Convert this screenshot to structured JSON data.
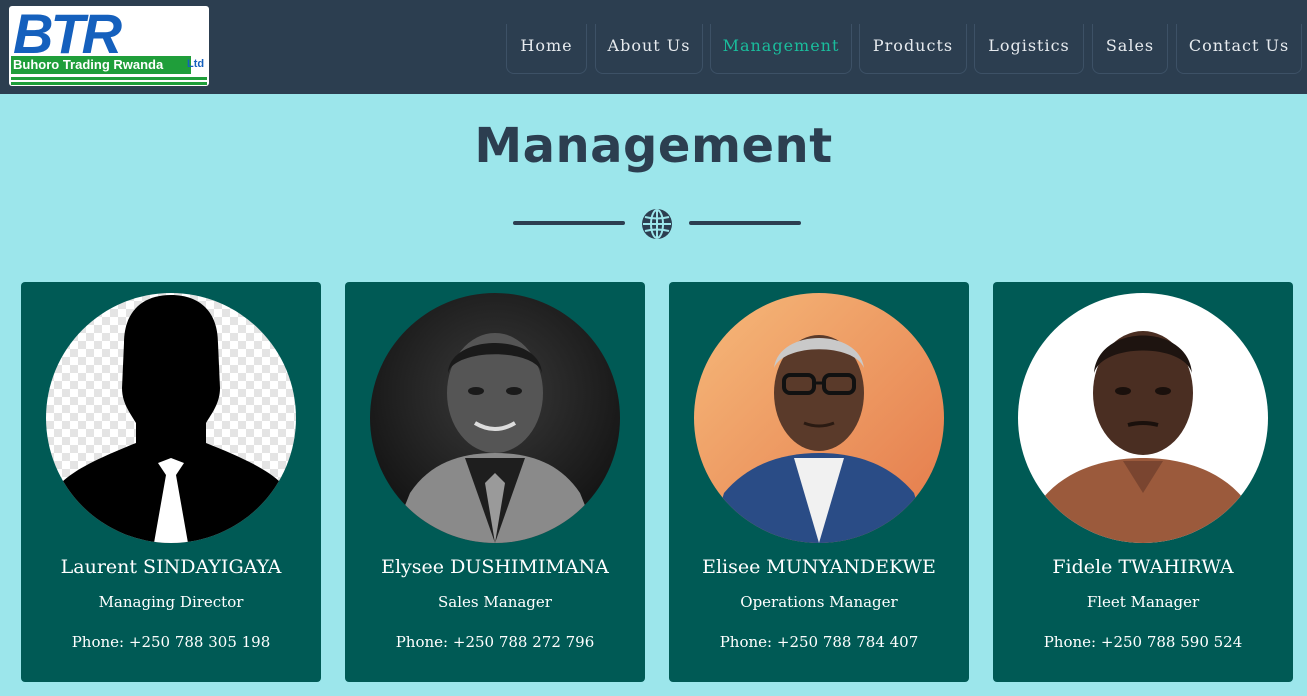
{
  "logo": {
    "letters": "BTR",
    "company_name": "Buhoro Trading Rwanda",
    "suffix": "Ltd"
  },
  "nav": {
    "items": [
      {
        "label": "Home",
        "active": false
      },
      {
        "label": "About Us",
        "active": false
      },
      {
        "label": "Management",
        "active": true
      },
      {
        "label": "Products",
        "active": false
      },
      {
        "label": "Logistics",
        "active": false
      },
      {
        "label": "Sales",
        "active": false
      },
      {
        "label": "Contact Us",
        "active": false
      }
    ]
  },
  "page": {
    "title": "Management",
    "divider_icon": "globe-icon"
  },
  "team": [
    {
      "name": "Laurent SINDAYIGAYA",
      "role": "Managing Director",
      "phone_label": "Phone:",
      "phone": "+250 788 305 198",
      "photo": "placeholder-silhouette"
    },
    {
      "name": "Elysee DUSHIMIMANA",
      "role": "Sales Manager",
      "phone_label": "Phone:",
      "phone": "+250 788 272 796",
      "photo": "portrait-grayscale"
    },
    {
      "name": "Elisee MUNYANDEKWE",
      "role": "Operations Manager",
      "phone_label": "Phone:",
      "phone": "+250 788 784 407",
      "photo": "portrait-color"
    },
    {
      "name": "Fidele TWAHIRWA",
      "role": "Fleet Manager",
      "phone_label": "Phone:",
      "phone": "+250 788 590 524",
      "photo": "portrait-color"
    }
  ],
  "colors": {
    "header_bg": "#2c3e50",
    "page_bg": "#9ce6eb",
    "card_bg": "#005a55",
    "nav_active": "#1abc9c",
    "title": "#2c3e50"
  }
}
